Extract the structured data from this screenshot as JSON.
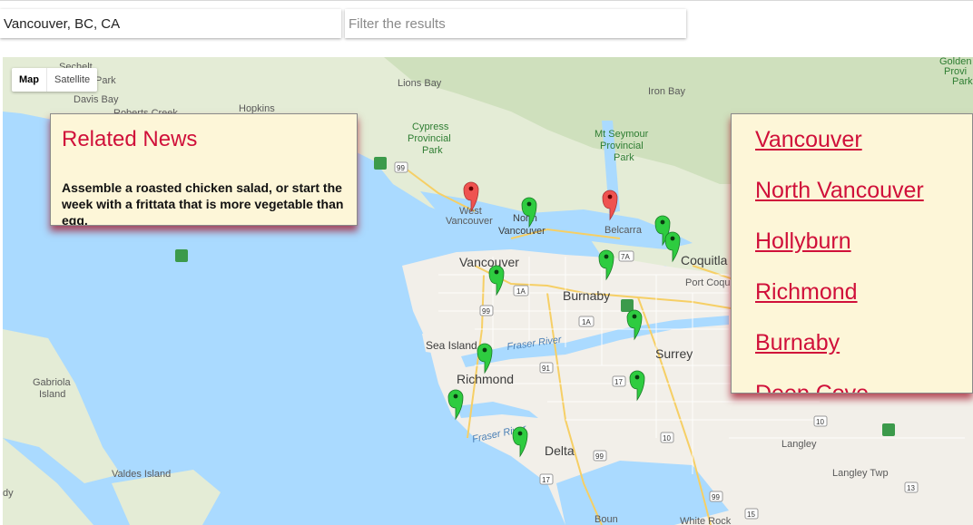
{
  "search": {
    "location_value": "Vancouver, BC, CA",
    "filter_placeholder": "Filter the results"
  },
  "map_controls": {
    "map_label": "Map",
    "satellite_label": "Satellite"
  },
  "news": {
    "title": "Related News",
    "item": "Assemble a roasted chicken salad, or start the week with a frittata that is more vegetable than egg."
  },
  "cities": [
    "Vancouver",
    "North Vancouver",
    "Hollyburn",
    "Richmond",
    "Burnaby",
    "Deep Cove"
  ],
  "map_labels": {
    "sechelt": "Sechelt",
    "park": "Park",
    "davis_bay": "Davis Bay",
    "roberts_creek": "Roberts Creek",
    "hopkins": "Hopkins",
    "lions_bay": "Lions Bay",
    "iron_bay": "Iron Bay",
    "cypress": "Cypress",
    "provincial": "Provincial",
    "cypress_park": "Park",
    "mt_seymour": "Mt Seymour",
    "seymour_provincial": "Provincial",
    "seymour_park": "Park",
    "golden": "Golden",
    "provi": "Provi",
    "park_r": "Park",
    "west": "West",
    "west_vancouver": "Vancouver",
    "north": "North",
    "north_vancouver": "Vancouver",
    "belcarra": "Belcarra",
    "vancouver": "Vancouver",
    "burnaby": "Burnaby",
    "coquitlam": "Coquitla",
    "port_coquitlam": "Port Coqu",
    "sea_island": "Sea Island",
    "richmond": "Richmond",
    "surrey": "Surrey",
    "delta": "Delta",
    "fraser_river": "Fraser River",
    "fraser_river_2": "Fraser River",
    "gabriola": "Gabriola",
    "gabriola_island": "Island",
    "valdes_island": "Valdes Island",
    "langley": "Langley",
    "langley_twp": "Langley Twp",
    "white_rock": "White Rock",
    "d": "d",
    "dy": "dy",
    "bound": "Boun"
  },
  "route_shields": [
    "99",
    "1A",
    "7A",
    "99",
    "1A",
    "91",
    "17",
    "10",
    "10",
    "13",
    "99",
    "15",
    "99",
    "17"
  ],
  "colors": {
    "accent": "#d0103a",
    "panel_bg": "#fdf6d8",
    "water": "#aadaff",
    "land": "#f2efe9",
    "pin_green": "#2ecc40",
    "pin_red": "#ef5350"
  }
}
